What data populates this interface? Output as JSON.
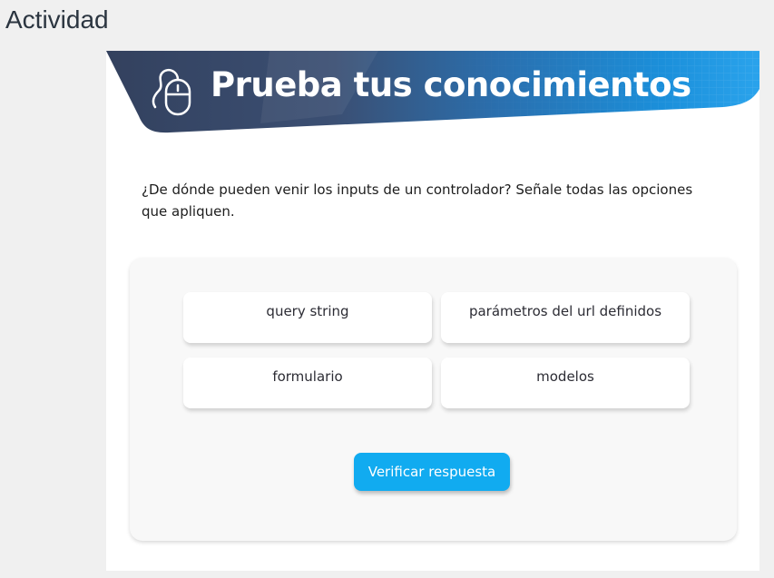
{
  "page": {
    "title": "Actividad"
  },
  "banner": {
    "title": "Prueba tus conocimientos",
    "icon": "mouse-icon"
  },
  "question": {
    "text": "¿De dónde pueden venir los inputs de un controlador? Señale todas las opciones que apliquen."
  },
  "options": [
    {
      "label": "query string"
    },
    {
      "label": "parámetros del url definidos"
    },
    {
      "label": "formulario"
    },
    {
      "label": "modelos"
    }
  ],
  "actions": {
    "verify_label": "Verificar respuesta"
  },
  "colors": {
    "background": "#f0f0f0",
    "banner_dark": "#2f3f5c",
    "banner_blue": "#1a8fd6",
    "accent": "#11abf0",
    "text": "#1d1d1d"
  }
}
